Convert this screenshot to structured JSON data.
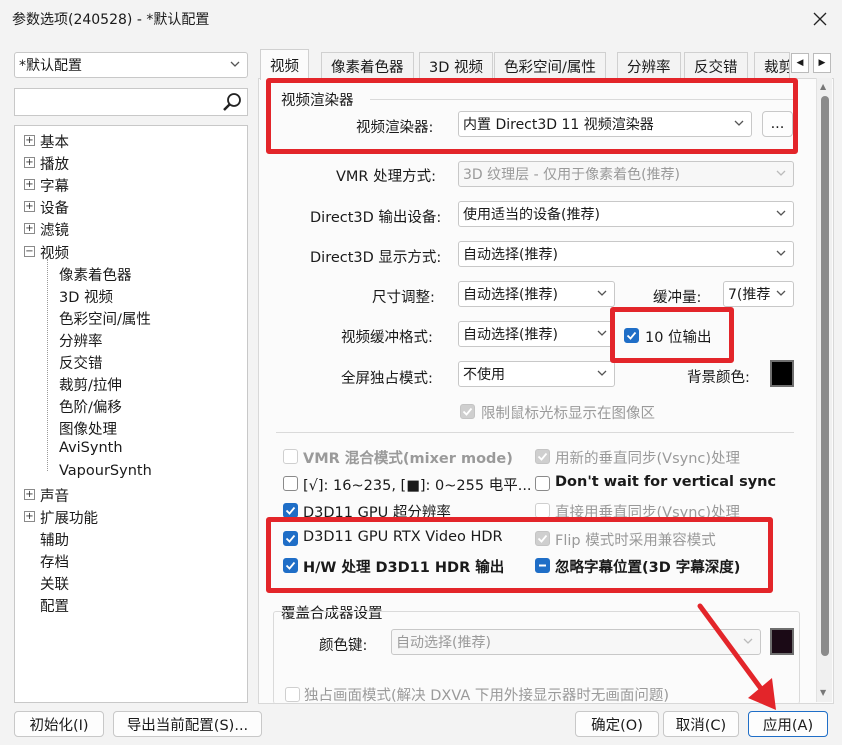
{
  "window": {
    "title": "参数选项(240528) - *默认配置"
  },
  "profile": {
    "selected": "*默认配置"
  },
  "search": {
    "value": ""
  },
  "tree": [
    {
      "label": "基本",
      "level": 0,
      "expander": "+"
    },
    {
      "label": "播放",
      "level": 0,
      "expander": "+"
    },
    {
      "label": "字幕",
      "level": 0,
      "expander": "+"
    },
    {
      "label": "设备",
      "level": 0,
      "expander": "+"
    },
    {
      "label": "滤镜",
      "level": 0,
      "expander": "+"
    },
    {
      "label": "视频",
      "level": 0,
      "expander": "−"
    },
    {
      "label": "像素着色器",
      "level": 1
    },
    {
      "label": "3D 视频",
      "level": 1
    },
    {
      "label": "色彩空间/属性",
      "level": 1
    },
    {
      "label": "分辨率",
      "level": 1
    },
    {
      "label": "反交错",
      "level": 1
    },
    {
      "label": "裁剪/拉伸",
      "level": 1
    },
    {
      "label": "色阶/偏移",
      "level": 1
    },
    {
      "label": "图像处理",
      "level": 1
    },
    {
      "label": "AviSynth",
      "level": 1
    },
    {
      "label": "VapourSynth",
      "level": 1
    },
    {
      "label": "声音",
      "level": 0,
      "expander": "+"
    },
    {
      "label": "扩展功能",
      "level": 0,
      "expander": "+"
    },
    {
      "label": "辅助",
      "level": 0
    },
    {
      "label": "存档",
      "level": 0
    },
    {
      "label": "关联",
      "level": 0
    },
    {
      "label": "配置",
      "level": 0
    }
  ],
  "tabs": [
    "视频",
    "像素着色器",
    "3D 视频",
    "色彩空间/属性",
    "分辨率",
    "反交错",
    "裁剪"
  ],
  "video": {
    "group_title": "视频渲染器",
    "renderer_label": "视频渲染器:",
    "renderer_value": "内置 Direct3D 11 视频渲染器",
    "renderer_more": "...",
    "vmr_label": "VMR 处理方式:",
    "vmr_value": "3D 纹理层 - 仅用于像素着色(推荐)",
    "d3d_device_label": "Direct3D 输出设备:",
    "d3d_device_value": "使用适当的设备(推荐)",
    "d3d_display_label": "Direct3D 显示方式:",
    "d3d_display_value": "自动选择(推荐)",
    "resize_label": "尺寸调整:",
    "resize_value": "自动选择(推荐)",
    "buffer_label": "缓冲量:",
    "buffer_value": "7(推荐",
    "surface_label": "视频缓冲格式:",
    "surface_value": "自动选择(推荐)",
    "ten_bit_label": "10 位输出",
    "exclusive_label": "全屏独占模式:",
    "exclusive_value": "不使用",
    "bgcolor_label": "背景颜色:",
    "limit_cursor_label": "限制鼠标光标显示在图像区"
  },
  "options": {
    "vmr_mixer": "VMR 混合模式(mixer mode)",
    "new_vsync": "用新的垂直同步(Vsync)处理",
    "levels": "[√]: 16~235, [■]: 0~255 电平...",
    "dont_wait": "Don't wait for vertical sync",
    "gpu_super_res": "D3D11 GPU 超分辨率",
    "direct_vsync": "直接用垂直同步(Vsync)处理",
    "rtx_hdr": "D3D11 GPU RTX Video HDR",
    "flip_compat": "Flip 模式时采用兼容模式",
    "hw_hdr_output": "H/W 处理 D3D11 HDR 输出",
    "ignore_sub_pos": "忽略字幕位置(3D 字幕深度)"
  },
  "overlay": {
    "group_title": "覆盖合成器设置",
    "colorkey_label": "颜色键:",
    "colorkey_value": "自动选择(推荐)",
    "standalone_label": "独占画面模式(解决 DXVA 下用外接显示器时无画面问题)"
  },
  "buttons": {
    "init": "初始化(I)",
    "export": "导出当前配置(S)...",
    "ok": "确定(O)",
    "cancel": "取消(C)",
    "apply": "应用(A)"
  },
  "colors": {
    "accent": "#1f6ec7",
    "highlight": "#e3252a"
  }
}
